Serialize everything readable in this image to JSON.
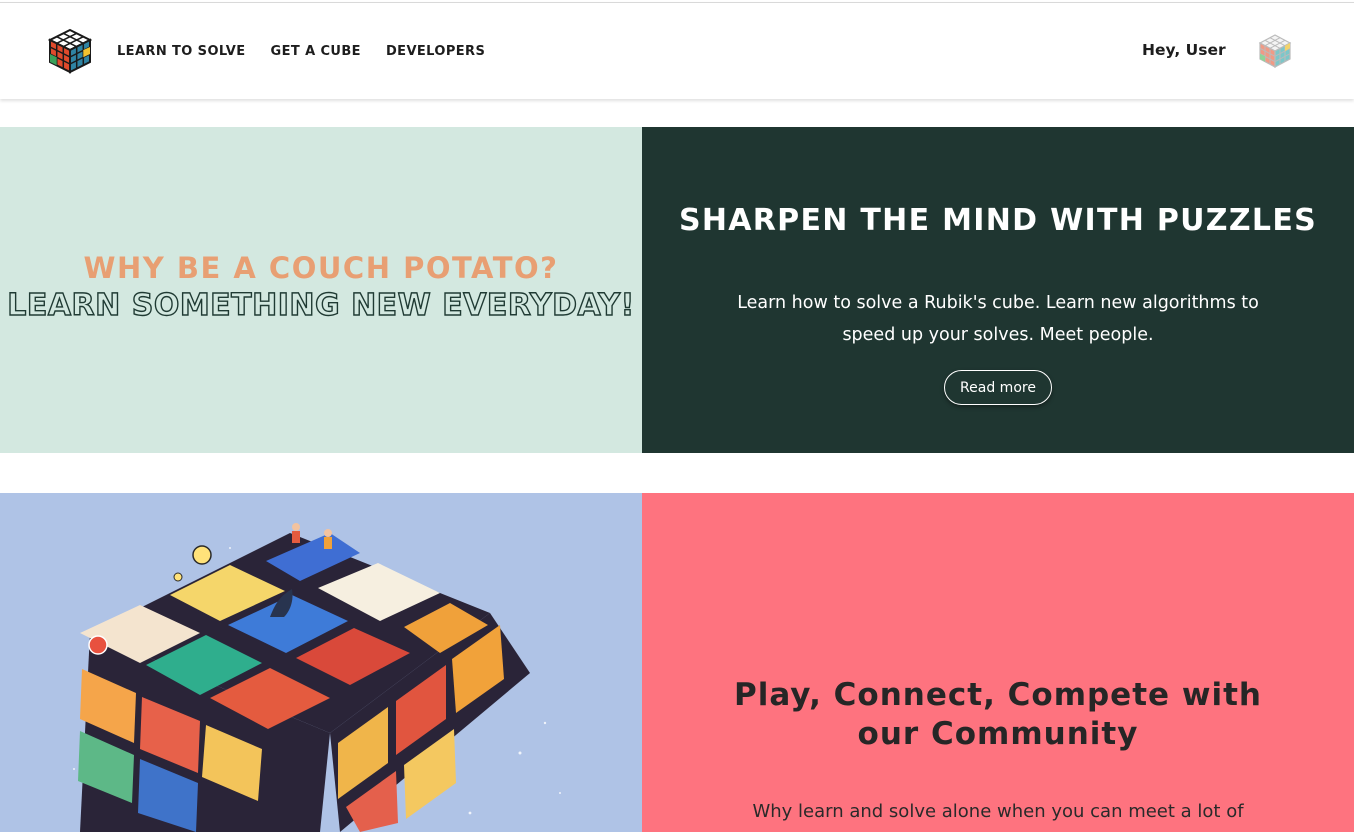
{
  "nav": {
    "logo_icon": "rubiks-cube-icon",
    "links": [
      {
        "label": "LEARN TO SOLVE"
      },
      {
        "label": "GET A CUBE"
      },
      {
        "label": "DEVELOPERS"
      }
    ],
    "greeting": "Hey, User",
    "avatar_icon": "rubiks-cube-avatar-icon"
  },
  "hero": {
    "tagline_1": "WHY BE A COUCH POTATO?",
    "tagline_2": "LEARN SOMETHING NEW EVERYDAY!",
    "title": "SHARPEN THE MIND WITH PUZZLES",
    "description": "Learn how to solve a Rubik's cube. Learn new algorithms to speed up your solves. Meet people.",
    "cta_label": "Read more"
  },
  "community": {
    "illustration_icon": "rubiks-cube-illustration",
    "title": "Play, Connect, Compete with our Community",
    "description": "Why learn and solve alone when you can meet a lot of"
  },
  "colors": {
    "hero_left_bg": "#d3e8e0",
    "hero_right_bg": "#1f3631",
    "accent_orange": "#e89f73",
    "illustration_bg": "#afc3e6",
    "community_bg": "#fe737f"
  }
}
